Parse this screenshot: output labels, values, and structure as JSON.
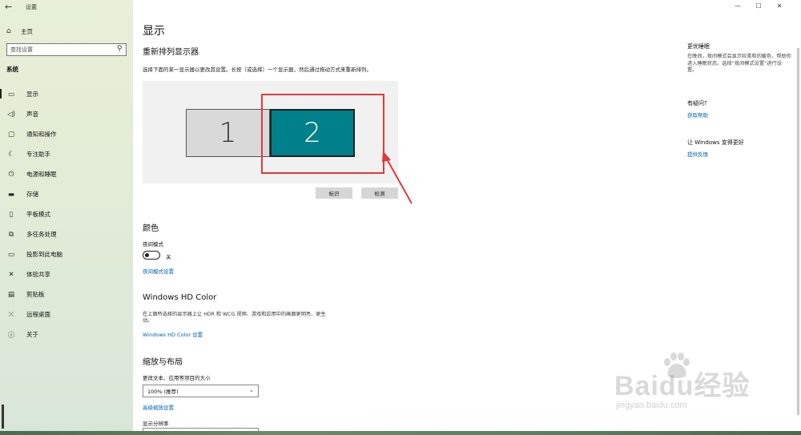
{
  "window": {
    "app_title": "设置",
    "back_icon": "arrow-left-icon",
    "controls": [
      "—",
      "☐",
      "✕"
    ]
  },
  "sidebar": {
    "home_label": "主页",
    "search_placeholder": "查找设置",
    "section_label": "系统",
    "items": [
      {
        "label": "显示",
        "icon": "monitor-icon",
        "active": true
      },
      {
        "label": "声音",
        "icon": "speaker-icon"
      },
      {
        "label": "通知和操作",
        "icon": "notification-icon"
      },
      {
        "label": "专注助手",
        "icon": "moon-icon"
      },
      {
        "label": "电源和睡眠",
        "icon": "power-icon"
      },
      {
        "label": "存储",
        "icon": "storage-icon"
      },
      {
        "label": "平板模式",
        "icon": "tablet-icon"
      },
      {
        "label": "多任务处理",
        "icon": "multitask-icon"
      },
      {
        "label": "投影到此电脑",
        "icon": "project-icon"
      },
      {
        "label": "体验共享",
        "icon": "share-icon"
      },
      {
        "label": "剪贴板",
        "icon": "clipboard-icon"
      },
      {
        "label": "远程桌面",
        "icon": "remote-desktop-icon"
      },
      {
        "label": "关于",
        "icon": "info-icon"
      }
    ]
  },
  "main": {
    "page_title": "显示",
    "arrange": {
      "heading": "重新排列显示器",
      "description": "选择下面的某一显示器以更改其设置。长按（或选择）一个显示器，然后通过拖动方式来重新排列。",
      "monitor1": "1",
      "monitor2": "2",
      "identify_button": "标识",
      "detect_button": "检测"
    },
    "color": {
      "heading": "颜色",
      "night_mode_label": "夜间模式",
      "toggle_state": "关",
      "night_mode_settings_link": "夜间模式设置"
    },
    "hdr": {
      "heading": "Windows HD Color",
      "description": "在上面所选择的显示器上让 HDR 和 WCG 视频、游戏和应用中的画面更明亮、更生动。",
      "settings_link": "Windows HD Color 设置"
    },
    "scale": {
      "heading": "缩放与布局",
      "size_label": "更改文本、应用等项目的大小",
      "size_value": "100% (推荐)",
      "advanced_link": "高级缩放设置",
      "resolution_label": "显示分辨率"
    }
  },
  "right": {
    "sleep_heading": "更优睡眠",
    "sleep_text": "在晚间，夜间模式会显示较柔和的暖色，帮助你进入睡眠状态。选择“夜间模式设置”进行设置。",
    "help_heading": "有疑问?",
    "help_link": "获取帮助",
    "feedback_heading": "让 Windows 变得更好",
    "feedback_link": "提供反馈"
  },
  "watermark": {
    "brand": "Baidu经验",
    "url": "jingyan.baidu.com"
  },
  "colors": {
    "accent": "#00808a",
    "link": "#0063b1",
    "highlight": "#e03a3a"
  }
}
